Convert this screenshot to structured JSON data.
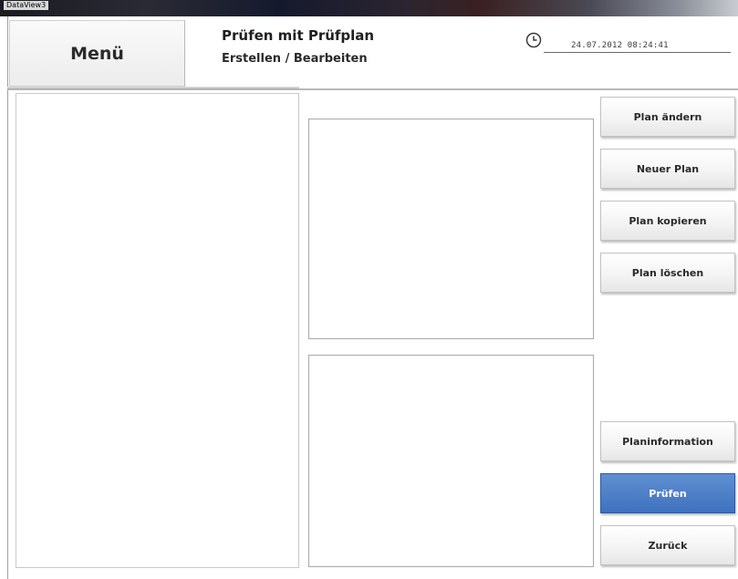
{
  "window": {
    "title": "DataView3"
  },
  "header": {
    "menu_label": "Menü",
    "title": "Prüfen mit Prüfplan",
    "subtitle": "Erstellen / Bearbeiten",
    "datetime": "24.07.2012  08:24:41",
    "clock_icon": "clock-icon"
  },
  "buttons": {
    "plan_aendern": "Plan ändern",
    "neuer_plan": "Neuer Plan",
    "plan_kopieren": "Plan kopieren",
    "plan_loeschen": "Plan löschen",
    "planinformation": "Planinformation",
    "pruefen": "Prüfen",
    "zurueck": "Zurück"
  },
  "colors": {
    "active_button": "#3f72bf"
  }
}
